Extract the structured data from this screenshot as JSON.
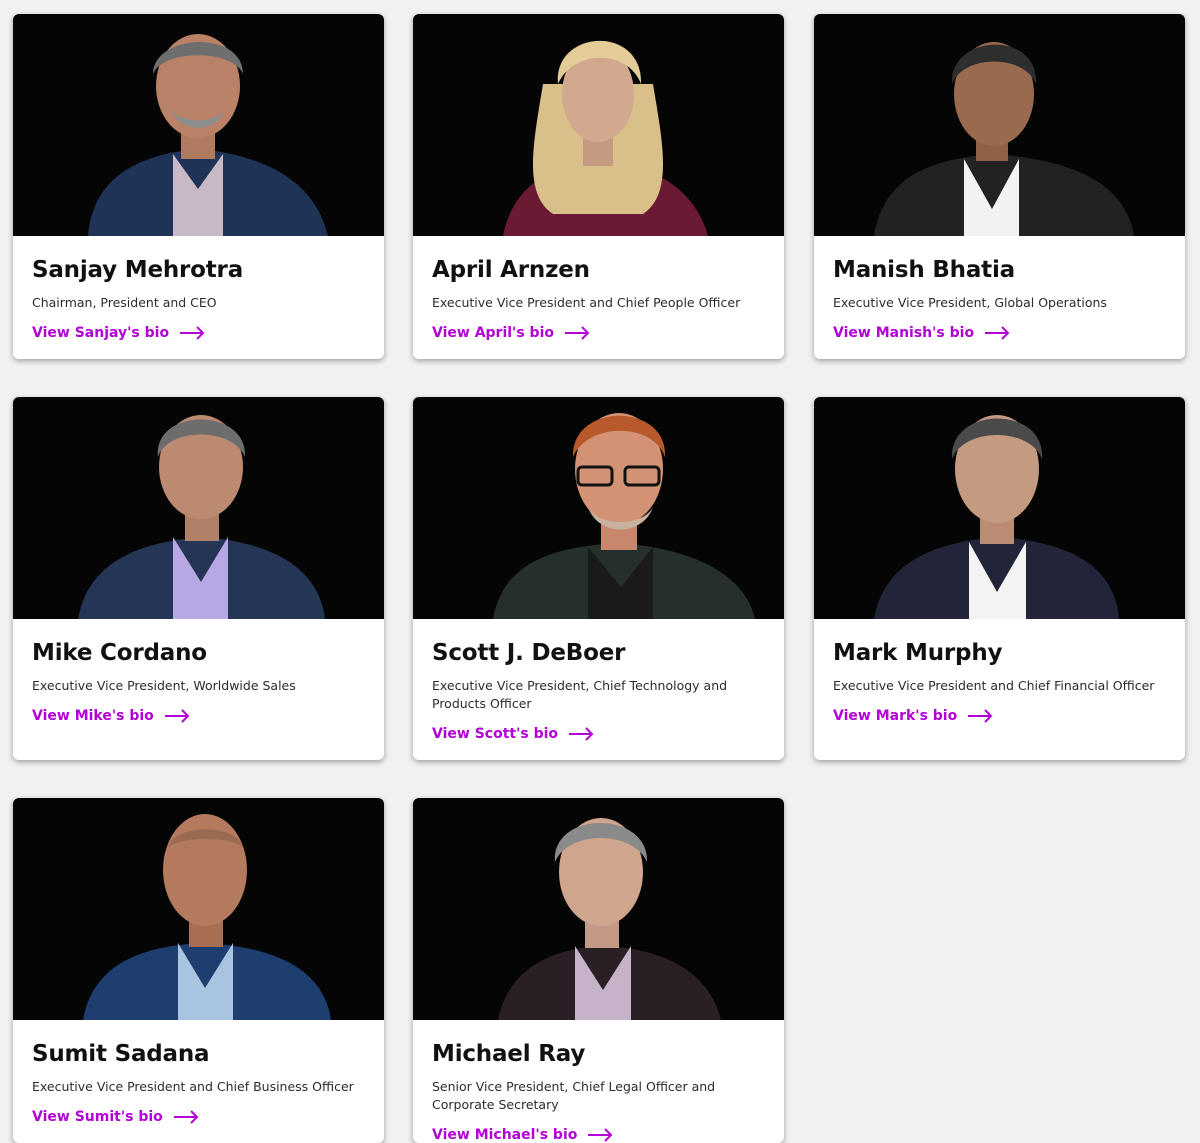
{
  "colors": {
    "background": "#f1f1f1",
    "card": "#ffffff",
    "photo_bg": "#050505",
    "link": "#b300d6",
    "name": "#111111"
  },
  "executives": [
    {
      "name": "Sanjay Mehrotra",
      "title": "Chairman, President and CEO",
      "link": "View Sanjay's bio",
      "icon": "arrow-right-icon"
    },
    {
      "name": "April Arnzen",
      "title": "Executive Vice President and Chief People Officer",
      "link": "View April's bio",
      "icon": "arrow-right-icon"
    },
    {
      "name": "Manish Bhatia",
      "title": "Executive Vice President, Global Operations",
      "link": "View Manish's bio",
      "icon": "arrow-right-icon"
    },
    {
      "name": "Mike Cordano",
      "title": "Executive Vice President, Worldwide Sales",
      "link": "View Mike's bio",
      "icon": "arrow-right-icon"
    },
    {
      "name": "Scott J. DeBoer",
      "title": "Executive Vice President, Chief Technology and Products Officer",
      "link": "View Scott's bio",
      "icon": "arrow-right-icon"
    },
    {
      "name": "Mark Murphy",
      "title": "Executive Vice President and Chief Financial Officer",
      "link": "View Mark's bio",
      "icon": "arrow-right-icon"
    },
    {
      "name": "Sumit Sadana",
      "title": "Executive Vice President and Chief Business Officer",
      "link": "View Sumit's bio",
      "icon": "arrow-right-icon"
    },
    {
      "name": "Michael Ray",
      "title": "Senior Vice President, Chief Legal Officer and Corporate Secretary",
      "link": "View Michael's bio",
      "icon": "arrow-right-icon"
    }
  ]
}
